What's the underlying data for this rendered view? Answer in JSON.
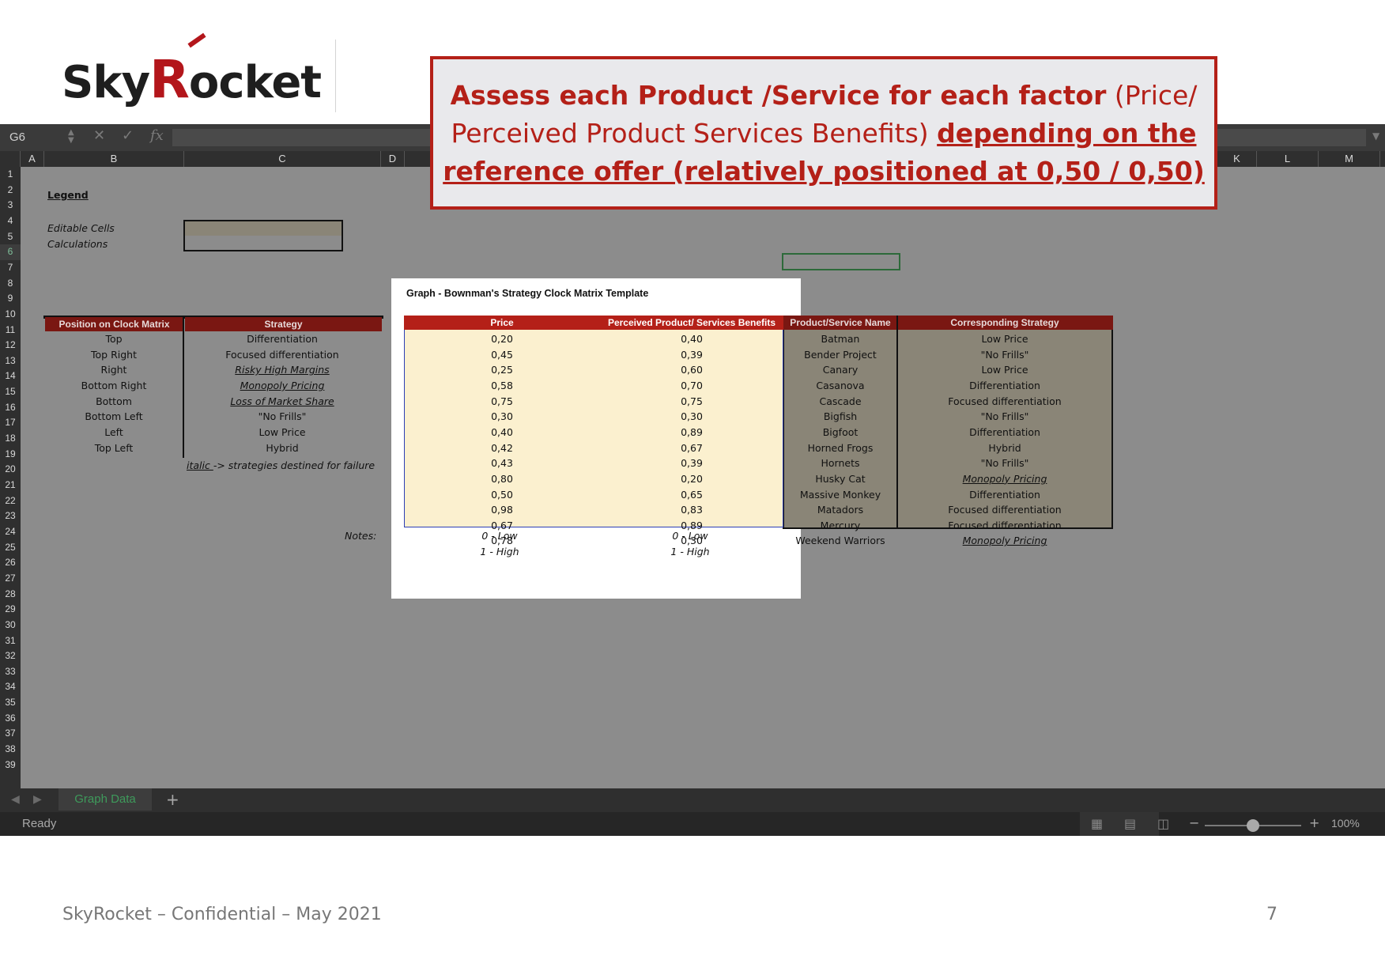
{
  "logo": {
    "text_pre": "Sky",
    "text_r": "R",
    "text_post": "ocket"
  },
  "callout": {
    "bold_red": "Assess each Product /Service for each factor",
    "normal_red": " (Price/ Perceived Product Services Benefits) ",
    "bold_underlined": "depending on the reference offer (relatively positioned at 0,50 / 0,50)"
  },
  "excel": {
    "namebox": "G6",
    "columns": [
      "A",
      "B",
      "C",
      "D",
      "K",
      "L",
      "M"
    ],
    "rows": [
      "1",
      "2",
      "3",
      "4",
      "5",
      "6",
      "7",
      "8",
      "9",
      "10",
      "11",
      "12",
      "13",
      "14",
      "15",
      "16",
      "17",
      "18",
      "19",
      "20",
      "21",
      "22",
      "23",
      "24",
      "25",
      "26",
      "27",
      "28",
      "29",
      "30",
      "31",
      "32",
      "33",
      "34",
      "35",
      "36",
      "37",
      "38",
      "39"
    ],
    "legend": {
      "title": "Legend",
      "editable": "Editable Cells",
      "calculations": "Calculations"
    },
    "clock_table": {
      "headers": [
        "Position on Clock Matrix",
        "Strategy"
      ],
      "rows": [
        [
          "Top",
          "Differentiation"
        ],
        [
          "Top Right",
          "Focused differentiation"
        ],
        [
          "Right",
          "Risky High Margins"
        ],
        [
          "Bottom Right",
          "Monopoly Pricing"
        ],
        [
          "Bottom",
          "Loss of Market Share"
        ],
        [
          "Bottom Left",
          "\"No Frills\""
        ],
        [
          "Left",
          "Low Price"
        ],
        [
          "Top Left",
          "Hybrid"
        ]
      ],
      "note_italic": "italic ",
      "note_rest": " -> strategies destined for failure"
    },
    "graph_title": "Graph - Bownman's Strategy Clock Matrix Template",
    "product_table": {
      "headers": [
        "Price",
        "Perceived Product/ Services Benefits",
        "Product/Service Name",
        "Corresponding Strategy"
      ],
      "rows": [
        [
          "0,20",
          "0,40",
          "Batman",
          "Low Price"
        ],
        [
          "0,45",
          "0,39",
          "Bender Project",
          "\"No Frills\""
        ],
        [
          "0,25",
          "0,60",
          "Canary",
          "Low Price"
        ],
        [
          "0,58",
          "0,70",
          "Casanova",
          "Differentiation"
        ],
        [
          "0,75",
          "0,75",
          "Cascade",
          "Focused differentiation"
        ],
        [
          "0,30",
          "0,30",
          "Bigfish",
          "\"No Frills\""
        ],
        [
          "0,40",
          "0,89",
          "Bigfoot",
          "Differentiation"
        ],
        [
          "0,42",
          "0,67",
          "Horned Frogs",
          "Hybrid"
        ],
        [
          "0,43",
          "0,39",
          "Hornets",
          "\"No Frills\""
        ],
        [
          "0,80",
          "0,20",
          "Husky Cat",
          "Monopoly Pricing"
        ],
        [
          "0,50",
          "0,65",
          "Massive Monkey",
          "Differentiation"
        ],
        [
          "0,98",
          "0,83",
          "Matadors",
          "Focused differentiation"
        ],
        [
          "0,67",
          "0,89",
          "Mercury",
          "Focused differentiation"
        ],
        [
          "0,78",
          "0,30",
          "Weekend Warriors",
          "Monopoly Pricing"
        ]
      ]
    },
    "notes": {
      "label": "Notes:",
      "price_low": "0 - Low",
      "price_high": "1 - High",
      "ben_low": "0 - Low",
      "ben_high": "1 - High"
    },
    "sheet_tab": "Graph Data",
    "add_tab": "+",
    "status": "Ready",
    "zoom": "100%"
  },
  "footer": {
    "text": "SkyRocket – Confidential – May 2021",
    "page": "7"
  }
}
